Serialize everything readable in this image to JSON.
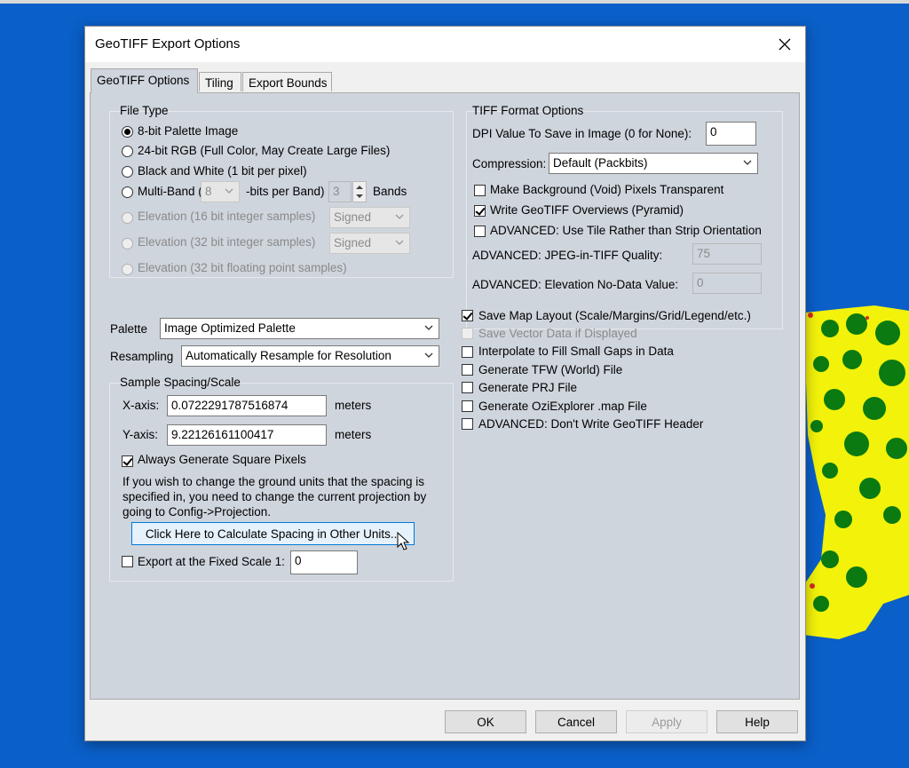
{
  "dialog": {
    "title": "GeoTIFF Export Options"
  },
  "tabs": [
    {
      "label": "GeoTIFF Options"
    },
    {
      "label": "Tiling"
    },
    {
      "label": "Export Bounds"
    }
  ],
  "file_type": {
    "title": "File Type",
    "options": [
      "8-bit Palette Image",
      "24-bit RGB (Full Color, May Create Large Files)",
      "Black and White (1 bit per pixel)",
      "Multi-Band (",
      "Elevation (16 bit integer samples)",
      "Elevation (32 bit integer samples)",
      "Elevation (32 bit floating point samples)"
    ],
    "multiband_bits": "8",
    "bits_label": "-bits per Band)",
    "multiband_bands": "3",
    "bands_label": "Bands",
    "signed_16": "Signed",
    "signed_32": "Signed"
  },
  "palette": {
    "label": "Palette",
    "value": "Image Optimized Palette"
  },
  "resampling": {
    "label": "Resampling",
    "value": "Automatically Resample for Resolution"
  },
  "spacing": {
    "title": "Sample Spacing/Scale",
    "x_label": "X-axis:",
    "x_value": "0.0722291787516874",
    "y_label": "Y-axis:",
    "y_value": "9.22126161100417",
    "units": "meters",
    "square_pixels": "Always Generate Square Pixels",
    "info_lines": [
      "If you wish to change the ground units that the spacing is",
      "specified in, you need to change the current projection by",
      "going to Config->Projection."
    ],
    "calc_button": "Click Here to Calculate Spacing in Other Units...",
    "fixed_scale_label": "Export at the Fixed Scale 1:",
    "fixed_scale_value": "0"
  },
  "tiff": {
    "title": "TIFF Format Options",
    "dpi_label": "DPI Value To Save in Image (0 for None):",
    "dpi_value": "0",
    "compression_label": "Compression:",
    "compression_value": "Default (Packbits)",
    "make_bg_transparent": "Make Background (Void) Pixels Transparent",
    "write_overviews": "Write GeoTIFF Overviews (Pyramid)",
    "use_tile": "ADVANCED: Use Tile Rather than Strip Orientation",
    "jpeg_label": "ADVANCED: JPEG-in-TIFF Quality:",
    "jpeg_value": "75",
    "nodata_label": "ADVANCED: Elevation No-Data Value:",
    "nodata_value": "0"
  },
  "options": {
    "save_layout": "Save Map Layout (Scale/Margins/Grid/Legend/etc.)",
    "save_vector": "Save Vector Data if Displayed",
    "interpolate": "Interpolate to Fill Small Gaps in Data",
    "tfw": "Generate TFW (World) File",
    "prj": "Generate PRJ File",
    "ozi": "Generate OziExplorer .map File",
    "no_header": "ADVANCED: Don't Write GeoTIFF Header"
  },
  "buttons": {
    "ok": "OK",
    "cancel": "Cancel",
    "apply": "Apply",
    "help": "Help"
  },
  "colors": {
    "desktop": "#0a5fc8",
    "panel": "#cfd5dd",
    "map_yellow": "#f2f20a",
    "map_green": "#0b7a10"
  }
}
